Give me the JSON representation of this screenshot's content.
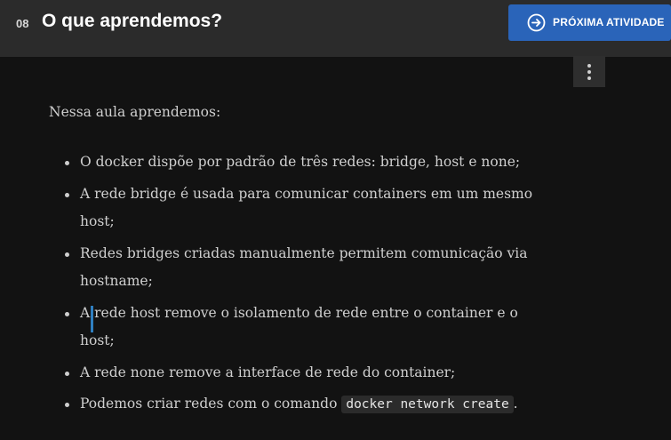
{
  "header": {
    "lesson_number": "08",
    "title": "O que aprendemos?",
    "next_button_label": "PRÓXIMA ATIVIDADE"
  },
  "content": {
    "intro": "Nessa aula aprendemos:",
    "items": [
      "O docker dispõe por padrão de três redes: bridge, host e none;",
      "A rede bridge é usada para comunicar containers em um mesmo host;",
      "Redes bridges criadas manualmente permitem comunicação via hostname;",
      {
        "lead": "A",
        "rest": " rede host remove o isolamento de rede entre o container e o host;"
      },
      "A rede none remove a interface de rede do container;",
      {
        "before": "Podemos criar redes com o comando ",
        "code": "docker network create",
        "after": "."
      }
    ]
  },
  "icons": {
    "next": "arrow-right-circle-icon",
    "more": "more-vertical-icon"
  },
  "colors": {
    "accent": "#2a64b9",
    "background": "#121212",
    "header_bg": "#2b2b2b"
  }
}
